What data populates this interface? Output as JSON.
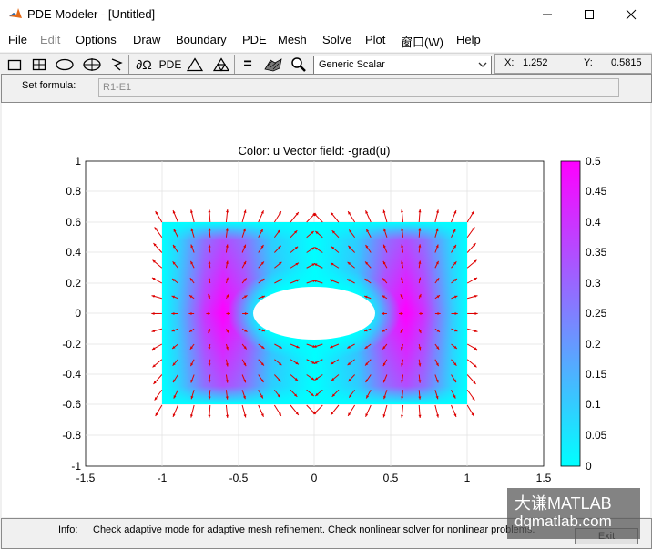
{
  "window": {
    "title": "PDE Modeler - [Untitled]"
  },
  "menu": [
    "File",
    "Edit",
    "Options",
    "Draw",
    "Boundary",
    "PDE",
    "Mesh",
    "Solve",
    "Plot",
    "窗口(W)",
    "Help"
  ],
  "toolbar": {
    "buttons": [
      {
        "icon": "rectangle-icon"
      },
      {
        "icon": "centered-rectangle-icon"
      },
      {
        "icon": "ellipse-icon"
      },
      {
        "icon": "centered-ellipse-icon"
      },
      {
        "icon": "polygon-icon"
      },
      {
        "icon": "boundary-mode-icon",
        "label": "∂Ω"
      },
      {
        "icon": "pde-specification-icon",
        "label": "PDE"
      },
      {
        "icon": "init-mesh-icon"
      },
      {
        "icon": "refine-mesh-icon"
      },
      {
        "icon": "solve-icon",
        "label": "="
      },
      {
        "icon": "plot-icon"
      },
      {
        "icon": "zoom-icon"
      }
    ],
    "application_mode": "Generic Scalar",
    "coords": {
      "x_label": "X:",
      "x_value": "1.252",
      "y_label": "Y:",
      "y_value": "0.5815"
    }
  },
  "formula": {
    "label": "Set formula:",
    "value": "R1-E1"
  },
  "plot": {
    "title": "Color: u  Vector field: -grad(u)",
    "x_ticks": [
      "-1.5",
      "-1",
      "-0.5",
      "0",
      "0.5",
      "1",
      "1.5"
    ],
    "y_ticks": [
      "1",
      "0.8",
      "0.6",
      "0.4",
      "0.2",
      "0",
      "-0.2",
      "-0.4",
      "-0.6",
      "-0.8",
      "-1"
    ],
    "colorbar_ticks": [
      "0.5",
      "0.45",
      "0.4",
      "0.35",
      "0.3",
      "0.25",
      "0.2",
      "0.15",
      "0.1",
      "0.05",
      "0"
    ],
    "colors": {
      "low": "#00ffff",
      "high": "#ff00ff",
      "arrow": "#dd0000"
    }
  },
  "chart_data": {
    "type": "heatmap",
    "title": "Color: u  Vector field: -grad(u)",
    "xlim": [
      -1.5,
      1.5
    ],
    "ylim": [
      -1,
      1
    ],
    "color_range": [
      0,
      0.5
    ],
    "domain": {
      "rectangle": {
        "x": [
          -1,
          1
        ],
        "y": [
          -0.6,
          0.6
        ]
      },
      "ellipse_hole": {
        "center": [
          0,
          0
        ],
        "semi_axes": [
          0.4,
          0.17
        ]
      }
    },
    "colorbar_ticks": [
      0,
      0.05,
      0.1,
      0.15,
      0.2,
      0.25,
      0.3,
      0.35,
      0.4,
      0.45,
      0.5
    ]
  },
  "status": {
    "label": "Info:",
    "text": "Check adaptive mode for adaptive mesh refinement. Check nonlinear solver for nonlinear problems.",
    "exit_label": "Exit"
  },
  "watermark": {
    "line1": "大谦MATLAB",
    "line2": "dqmatlab.com"
  }
}
